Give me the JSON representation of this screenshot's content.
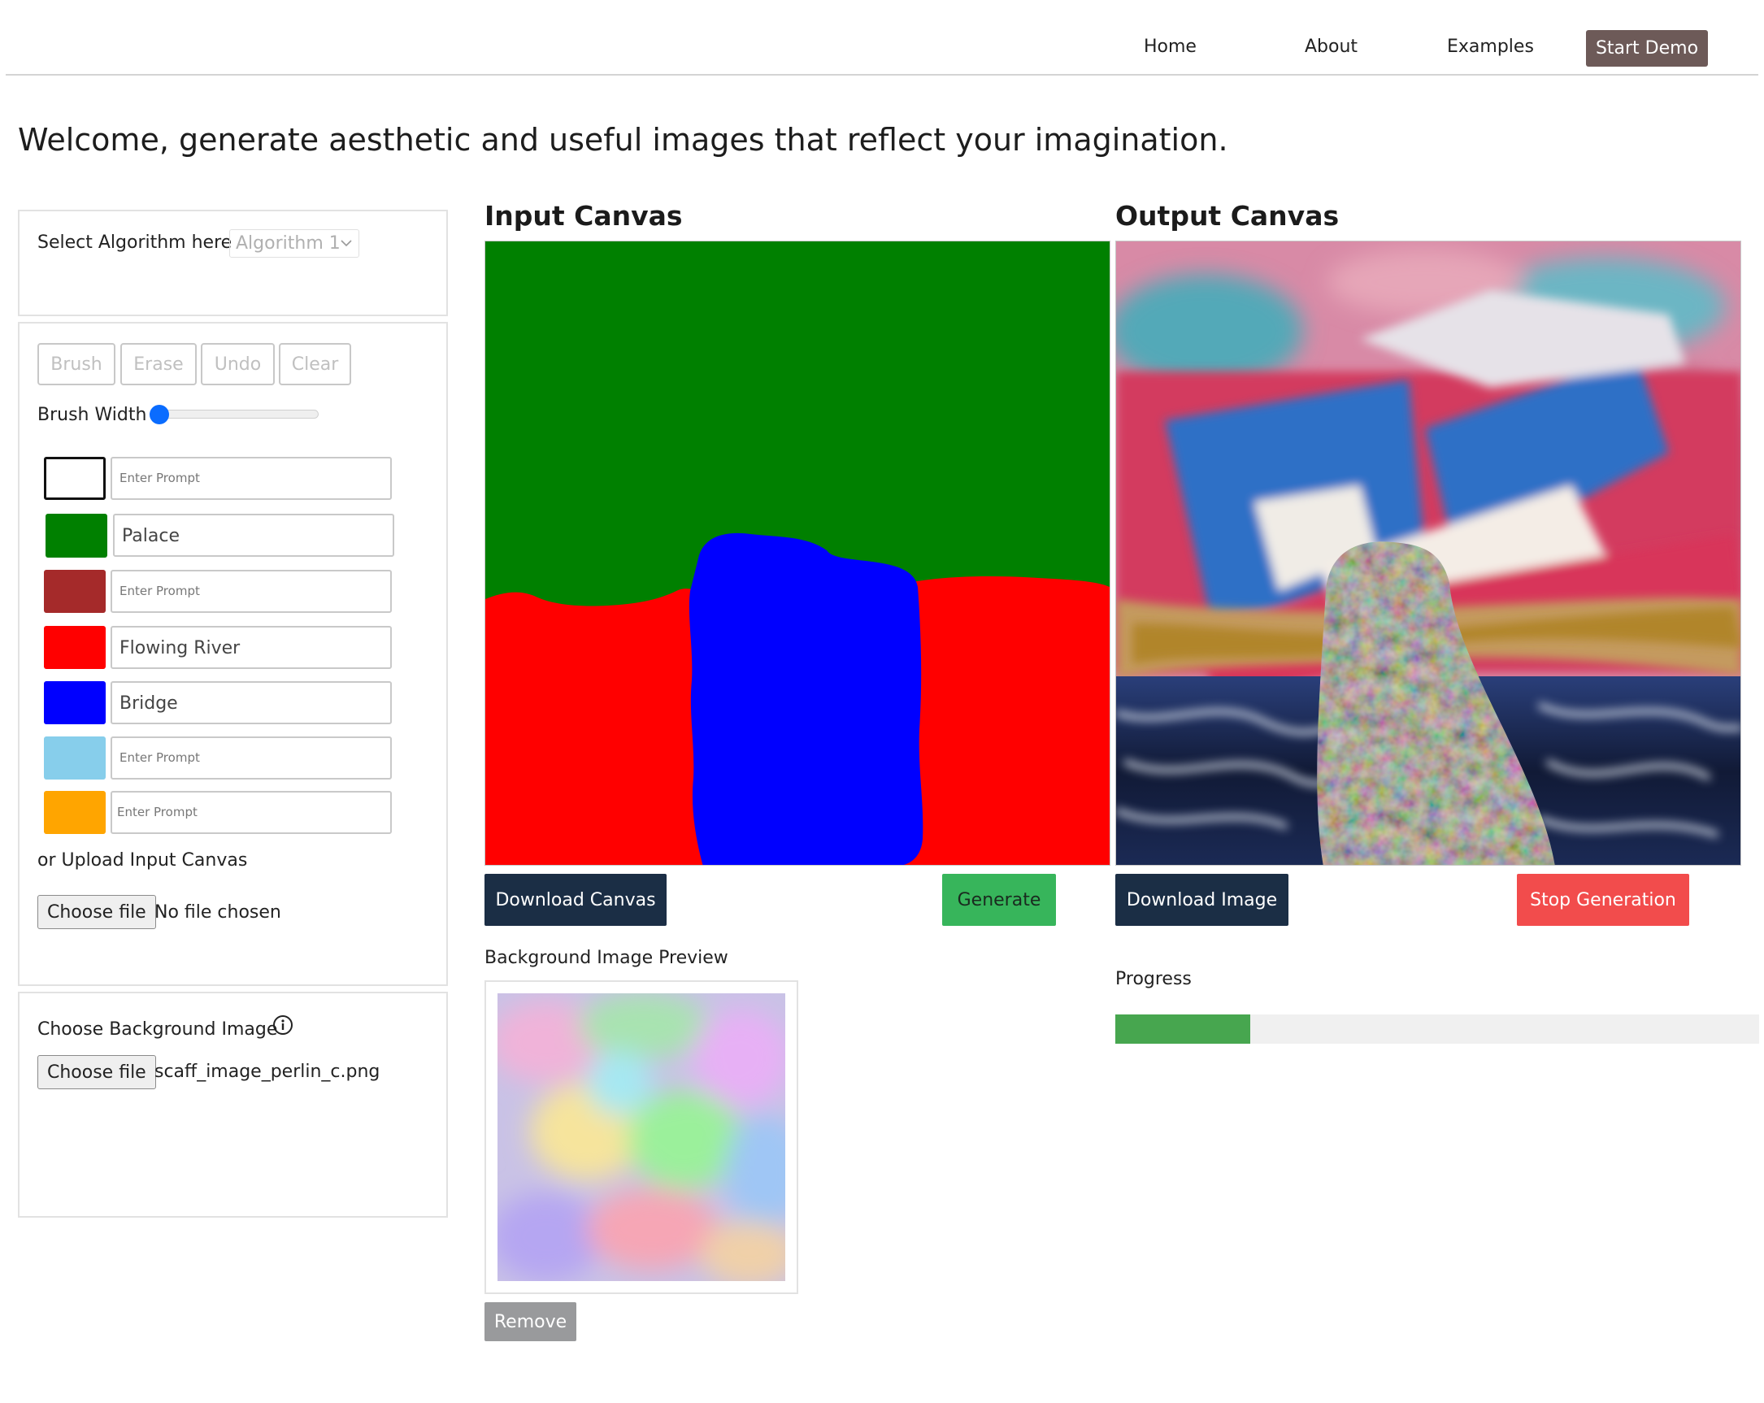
{
  "nav": {
    "home": "Home",
    "about": "About",
    "examples": "Examples",
    "start_demo": "Start Demo"
  },
  "welcome": "Welcome, generate aesthetic and useful images that reflect your imagination.",
  "algorithm": {
    "label": "Select Algorithm here",
    "selected": "Algorithm 1"
  },
  "tools": {
    "brush": "Brush",
    "erase": "Erase",
    "undo": "Undo",
    "clear": "Clear",
    "brush_width_label": "Brush Width",
    "brush_width_value": 0
  },
  "prompts": [
    {
      "color": "#ffffff",
      "value": "",
      "placeholder": "Enter Prompt",
      "selected": true
    },
    {
      "color": "#008000",
      "value": "Palace",
      "placeholder": "Enter Prompt"
    },
    {
      "color": "#a52a2a",
      "value": "",
      "placeholder": "Enter Prompt"
    },
    {
      "color": "#ff0000",
      "value": "Flowing River",
      "placeholder": "Enter Prompt"
    },
    {
      "color": "#0000ff",
      "value": "Bridge",
      "placeholder": "Enter Prompt"
    },
    {
      "color": "#87ceeb",
      "value": "",
      "placeholder": "Enter Prompt"
    },
    {
      "color": "#ffa500",
      "value": "",
      "placeholder": "Enter Prompt"
    }
  ],
  "upload": {
    "label": "or Upload Input Canvas",
    "button": "Choose file",
    "file": "No file chosen"
  },
  "background": {
    "label": "Choose Background Image",
    "button": "Choose file",
    "file": "scaff_image_perlin_c.png",
    "preview_label": "Background Image Preview",
    "remove": "Remove"
  },
  "input_canvas": {
    "title": "Input Canvas",
    "download": "Download Canvas",
    "generate": "Generate"
  },
  "output_canvas": {
    "title": "Output Canvas",
    "download": "Download Image",
    "stop": "Stop Generation"
  },
  "progress": {
    "label": "Progress",
    "fraction": 0.21
  },
  "colors": {
    "nav_button": "#6d5a58",
    "dark_button": "#1b2e45",
    "generate": "#37b55b",
    "stop": "#f24c4c",
    "progress": "#47a64f"
  }
}
